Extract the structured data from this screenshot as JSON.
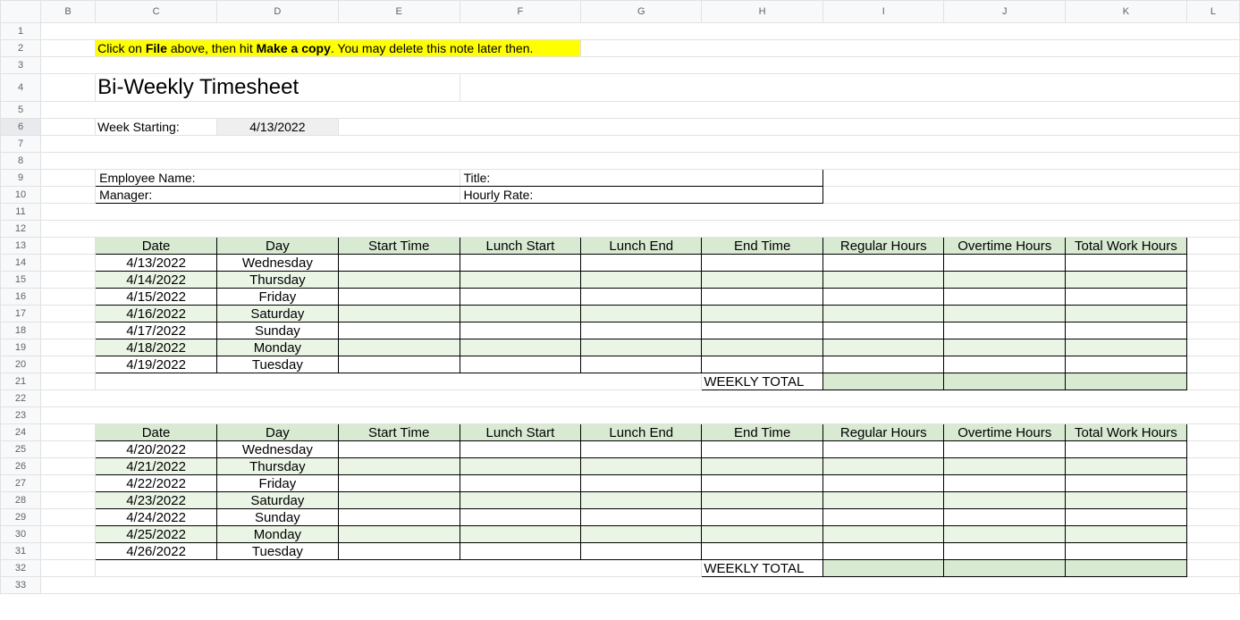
{
  "columns": [
    "B",
    "C",
    "D",
    "E",
    "F",
    "G",
    "H",
    "I",
    "J",
    "K",
    "L"
  ],
  "rows": [
    "1",
    "2",
    "3",
    "4",
    "5",
    "6",
    "7",
    "8",
    "9",
    "10",
    "11",
    "12",
    "13",
    "14",
    "15",
    "16",
    "17",
    "18",
    "19",
    "20",
    "21",
    "22",
    "23",
    "24",
    "25",
    "26",
    "27",
    "28",
    "29",
    "30",
    "31",
    "32",
    "33"
  ],
  "note": {
    "pre": "Click on ",
    "b1": "File",
    "mid": " above, then hit ",
    "b2": "Make a copy",
    "post": ". You may delete this note later then."
  },
  "title": "Bi-Weekly Timesheet",
  "week_starting_label": "Week Starting:",
  "week_starting_value": "4/13/2022",
  "info": {
    "employee": "Employee Name:",
    "title": "Title:",
    "manager": "Manager:",
    "rate": "Hourly Rate:"
  },
  "headers": [
    "Date",
    "Day",
    "Start Time",
    "Lunch Start",
    "Lunch End",
    "End Time",
    "Regular Hours",
    "Overtime Hours",
    "Total Work Hours"
  ],
  "weekly_total": "WEEKLY TOTAL",
  "week1": [
    {
      "date": "4/13/2022",
      "day": "Wednesday"
    },
    {
      "date": "4/14/2022",
      "day": "Thursday"
    },
    {
      "date": "4/15/2022",
      "day": "Friday"
    },
    {
      "date": "4/16/2022",
      "day": "Saturday"
    },
    {
      "date": "4/17/2022",
      "day": "Sunday"
    },
    {
      "date": "4/18/2022",
      "day": "Monday"
    },
    {
      "date": "4/19/2022",
      "day": "Tuesday"
    }
  ],
  "week2": [
    {
      "date": "4/20/2022",
      "day": "Wednesday"
    },
    {
      "date": "4/21/2022",
      "day": "Thursday"
    },
    {
      "date": "4/22/2022",
      "day": "Friday"
    },
    {
      "date": "4/23/2022",
      "day": "Saturday"
    },
    {
      "date": "4/24/2022",
      "day": "Sunday"
    },
    {
      "date": "4/25/2022",
      "day": "Monday"
    },
    {
      "date": "4/26/2022",
      "day": "Tuesday"
    }
  ],
  "chart_data": {
    "type": "table",
    "title": "Bi-Weekly Timesheet",
    "week_starting": "4/13/2022",
    "columns": [
      "Date",
      "Day",
      "Start Time",
      "Lunch Start",
      "Lunch End",
      "End Time",
      "Regular Hours",
      "Overtime Hours",
      "Total Work Hours"
    ],
    "weeks": [
      [
        [
          "4/13/2022",
          "Wednesday",
          "",
          "",
          "",
          "",
          "",
          "",
          ""
        ],
        [
          "4/14/2022",
          "Thursday",
          "",
          "",
          "",
          "",
          "",
          "",
          ""
        ],
        [
          "4/15/2022",
          "Friday",
          "",
          "",
          "",
          "",
          "",
          "",
          ""
        ],
        [
          "4/16/2022",
          "Saturday",
          "",
          "",
          "",
          "",
          "",
          "",
          ""
        ],
        [
          "4/17/2022",
          "Sunday",
          "",
          "",
          "",
          "",
          "",
          "",
          ""
        ],
        [
          "4/18/2022",
          "Monday",
          "",
          "",
          "",
          "",
          "",
          "",
          ""
        ],
        [
          "4/19/2022",
          "Tuesday",
          "",
          "",
          "",
          "",
          "",
          "",
          ""
        ]
      ],
      [
        [
          "4/20/2022",
          "Wednesday",
          "",
          "",
          "",
          "",
          "",
          "",
          ""
        ],
        [
          "4/21/2022",
          "Thursday",
          "",
          "",
          "",
          "",
          "",
          "",
          ""
        ],
        [
          "4/22/2022",
          "Friday",
          "",
          "",
          "",
          "",
          "",
          "",
          ""
        ],
        [
          "4/23/2022",
          "Saturday",
          "",
          "",
          "",
          "",
          "",
          "",
          ""
        ],
        [
          "4/24/2022",
          "Sunday",
          "",
          "",
          "",
          "",
          "",
          "",
          ""
        ],
        [
          "4/25/2022",
          "Monday",
          "",
          "",
          "",
          "",
          "",
          "",
          ""
        ],
        [
          "4/26/2022",
          "Tuesday",
          "",
          "",
          "",
          "",
          "",
          "",
          ""
        ]
      ]
    ]
  }
}
